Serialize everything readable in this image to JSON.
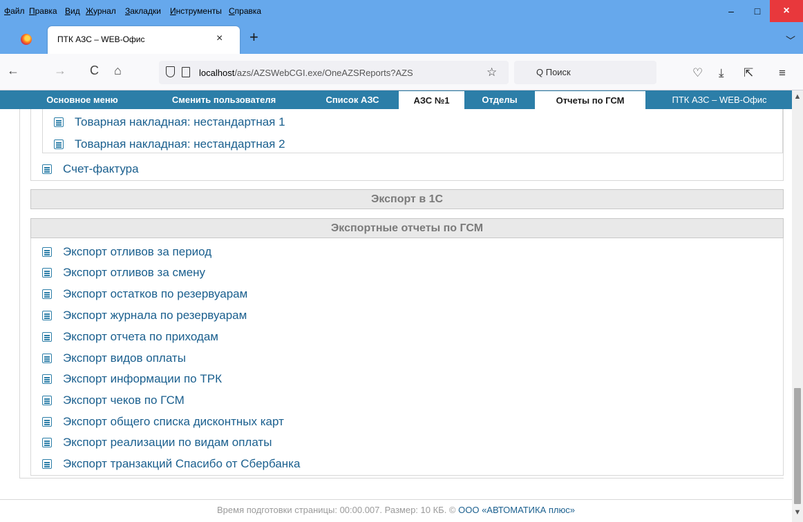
{
  "menubar": {
    "items": [
      "Файл",
      "Правка",
      "Вид",
      "Журнал",
      "Закладки",
      "Инструменты",
      "Справка"
    ],
    "underlined": [
      "Ф",
      "П",
      "В",
      "Ж",
      "З",
      "И",
      "С"
    ],
    "rest": [
      "айл",
      "равка",
      "ид",
      "урнал",
      "акладки",
      "нструменты",
      "правка"
    ]
  },
  "window": {
    "minimize": "–",
    "maximize": "□",
    "close": "×"
  },
  "tab": {
    "title": "ПТК АЗС – WEB-Офис",
    "close": "×",
    "new_tab": "+",
    "overflow": "﹀"
  },
  "navbar": {
    "back": "←",
    "forward": "→",
    "reload": "C",
    "home": "⌂",
    "url_host": "localhost",
    "url_path": "/azs/AZSWebCGI.exe/OneAZSReports?AZS",
    "bookmark": "☆",
    "search_placeholder": "Q Поиск",
    "pocket": "♡",
    "downloads": "⤓",
    "share": "⇱",
    "menu": "≡"
  },
  "pagenav": {
    "tabs": [
      "Основное меню",
      "Сменить пользователя",
      "Список АЗС",
      "АЗС №1",
      "Отделы",
      "Отчеты по ГСМ",
      "ПТК АЗС – WEB-Офис"
    ],
    "active": [
      "АЗС №1",
      "Отчеты по ГСМ"
    ]
  },
  "top_reports": {
    "sub": [
      "Товарная накладная: нестандартная 1",
      "Товарная накладная: нестандартная 2"
    ],
    "main": "Счет-фактура"
  },
  "sections": {
    "export_1c": "Экспорт в 1С",
    "export_gsm": "Экспортные отчеты по ГСМ"
  },
  "export_reports": [
    "Экспорт отливов за период",
    "Экспорт отливов за смену",
    "Экспорт остатков по резервуарам",
    "Экспорт журнала по резервуарам",
    "Экспорт отчета по приходам",
    "Экспорт видов оплаты",
    "Экспорт информации по ТРК",
    "Экспорт чеков по ГСМ",
    "Экспорт общего списка дисконтных карт",
    "Экспорт реализации по видам оплаты",
    "Экспорт транзакций Спасибо от Сбербанка"
  ],
  "footer": {
    "text": "Время подготовки страницы: 00:00.007. Размер: 10 КБ. © ",
    "company": "ООО «АВТОМАТИКА плюс»"
  },
  "scrollbar": {
    "up": "▲",
    "down": "▼"
  },
  "colors": {
    "chrome": "#66a8ec",
    "pagenav": "#2c7ea8",
    "link": "#1a5f8e",
    "close": "#e8383c"
  }
}
